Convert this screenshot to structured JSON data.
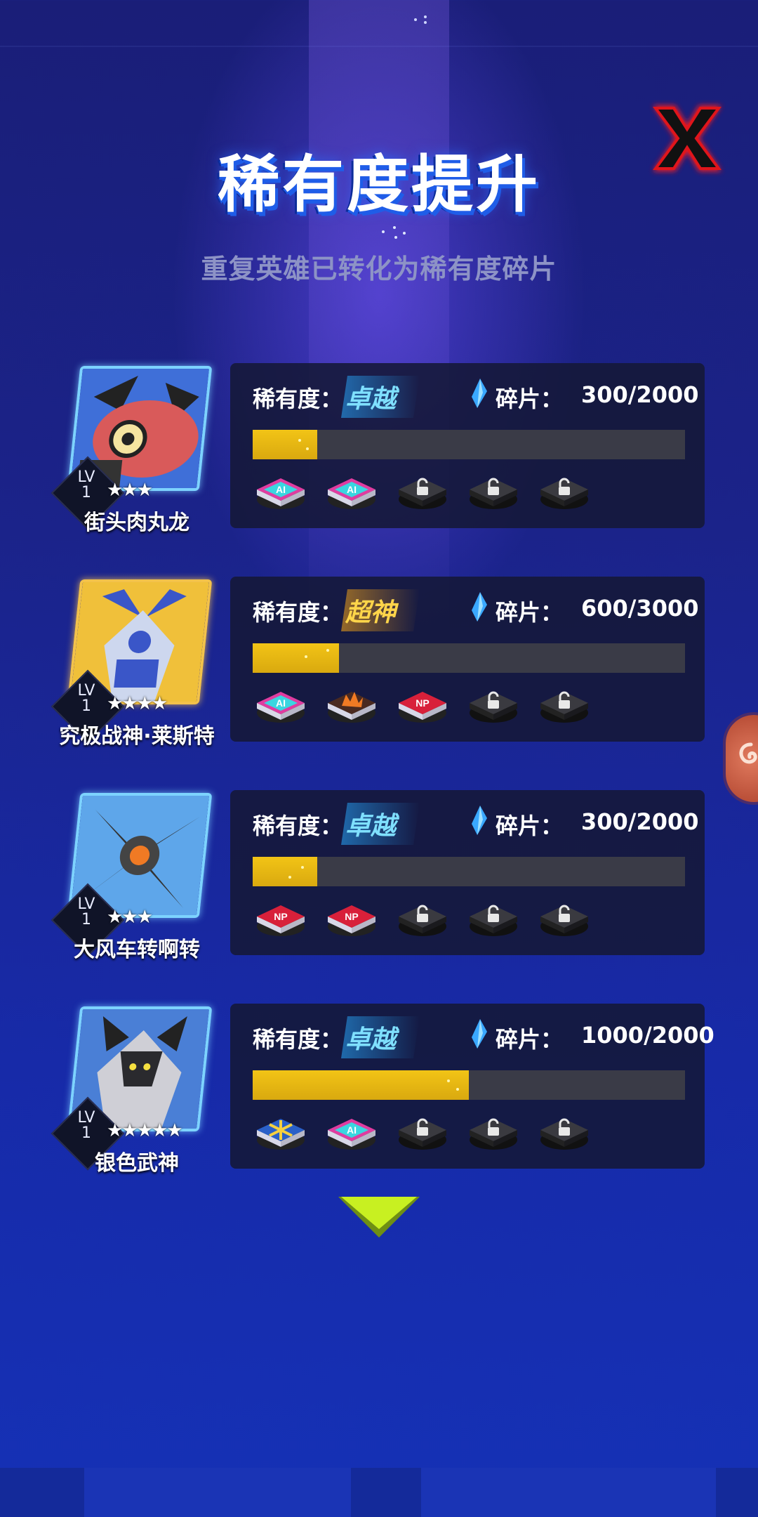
{
  "dialog": {
    "title": "稀有度提升",
    "subtitle": "重复英雄已转化为稀有度碎片",
    "close_icon": "red-x-icon",
    "scroll_icon": "chevron-down-icon"
  },
  "labels": {
    "rarity": "稀有度：",
    "shards": "碎片："
  },
  "colors": {
    "progress": "#f2c416",
    "rarity_blue": "#7fe0ff",
    "rarity_gold": "#ffd54a",
    "close": "#e0151b"
  },
  "heroes": [
    {
      "name": "街头肉丸龙",
      "level_label": "LV",
      "level": "1",
      "stars": "★★★",
      "rarity": "卓越",
      "rarity_tier": "blue",
      "shards": "300/2000",
      "progress": 0.15,
      "chips": [
        "ai-chip-icon",
        "ai-chip-icon",
        "lock-icon",
        "lock-icon",
        "lock-icon"
      ]
    },
    {
      "name": "究极战神·莱斯特",
      "level_label": "LV",
      "level": "1",
      "stars": "★★★★",
      "rarity": "超神",
      "rarity_tier": "gold",
      "shards": "600/3000",
      "progress": 0.2,
      "chips": [
        "ai-chip-icon",
        "fire-chip-icon",
        "np-chip-icon",
        "lock-icon",
        "lock-icon"
      ]
    },
    {
      "name": "大风车转啊转",
      "level_label": "LV",
      "level": "1",
      "stars": "★★★",
      "rarity": "卓越",
      "rarity_tier": "blue",
      "shards": "300/2000",
      "progress": 0.15,
      "chips": [
        "np-chip-icon",
        "np-chip-icon",
        "lock-icon",
        "lock-icon",
        "lock-icon"
      ]
    },
    {
      "name": "银色武神",
      "level_label": "LV",
      "level": "1",
      "stars": "★★★★★",
      "rarity": "卓越",
      "rarity_tier": "blue",
      "shards": "1000/2000",
      "progress": 0.5,
      "chips": [
        "spark-chip-icon",
        "ai-chip-icon",
        "lock-icon",
        "lock-icon",
        "lock-icon"
      ]
    }
  ]
}
